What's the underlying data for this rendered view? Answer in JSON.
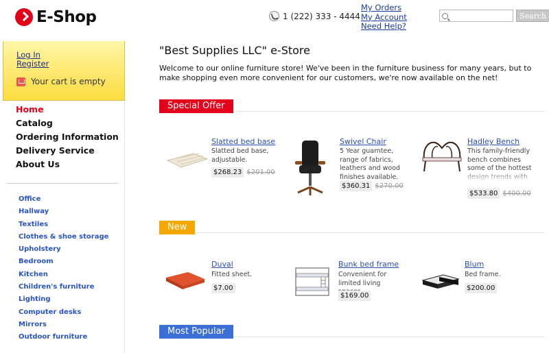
{
  "brand": {
    "name": "E-Shop",
    "color": "#e3001b"
  },
  "header": {
    "phone": "1 (222) 333 - 4444",
    "links": [
      "My Orders",
      "My Account",
      "Need Help?"
    ],
    "search_placeholder": "",
    "search_button": "Search"
  },
  "sidebar": {
    "login": "Log In",
    "register": "Register",
    "cart": "Your cart is empty",
    "main_nav": [
      "Home",
      "Catalog",
      "Ordering Information",
      "Delivery Service",
      "About Us"
    ],
    "categories": [
      "Office",
      "Hallway",
      "Textiles",
      "Clothes & shoe storage",
      "Upholstery",
      "Bedroom",
      "Kitchen",
      "Children's furniture",
      "Lighting",
      "Computer desks",
      "Mirrors",
      "Outdoor furniture"
    ]
  },
  "main": {
    "title": "\"Best Supplies LLC\" e-Store",
    "welcome": "Welcome to our online furniture store! We've been in the furniture business for many years, but to make shopping even more convenient for our customers, we're now available on the net!",
    "sections": [
      {
        "label": "Special Offer",
        "color": "#e3001b",
        "products": [
          {
            "name": "Slatted bed base",
            "desc": "Slatted bed base, adjustable.",
            "price": "$268.23",
            "old_price": "$201.00",
            "icon": "bed-base-image"
          },
          {
            "name": "Swivel Chair",
            "desc": "5 Year guarntee, range of fabrics, leathers and wood finishes available.",
            "price": "$360.31",
            "old_price": "$270.00",
            "icon": "swivel-chair-image"
          },
          {
            "name": "Hadley Bench",
            "desc": "This family-friendly bench combines some of the hottest design trends with remarkable",
            "price": "$533.80",
            "old_price": "$400.00",
            "icon": "bench-image"
          }
        ]
      },
      {
        "label": "New",
        "color": "#f5a800",
        "products": [
          {
            "name": "Duval",
            "desc": "Fitted sheet.",
            "price": "$7.00",
            "icon": "sheet-image"
          },
          {
            "name": "Bunk bed frame",
            "desc": "Convenient for limited living spaces.",
            "price": "$169.00",
            "icon": "bunk-bed-image"
          },
          {
            "name": "Blum",
            "desc": "Bed frame.",
            "price": "$200.00",
            "icon": "bed-frame-image"
          }
        ]
      },
      {
        "label": "Most Popular",
        "color": "#3b6fd6",
        "products": []
      }
    ]
  }
}
